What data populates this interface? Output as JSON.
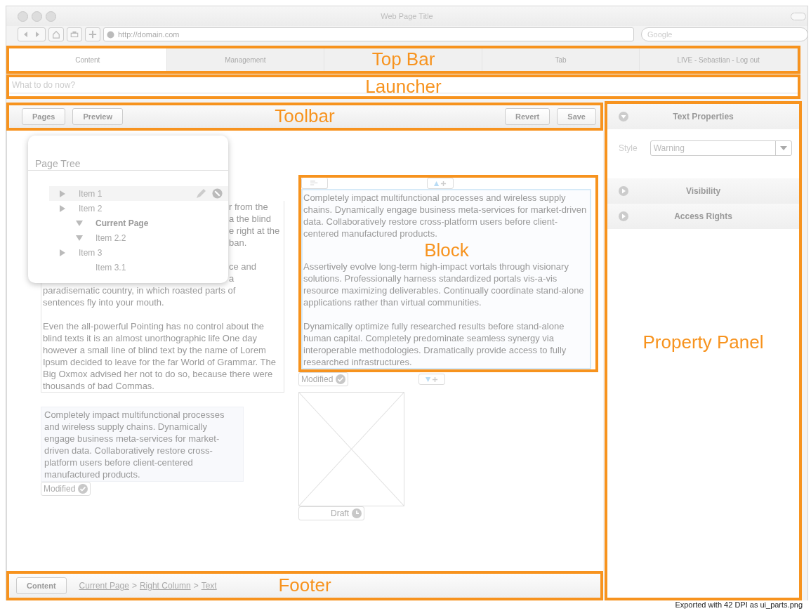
{
  "browser": {
    "title": "Web Page Title",
    "url": "http://domain.com",
    "search_placeholder": "Google"
  },
  "top_bar": {
    "annotation": "Top Bar",
    "tabs": [
      {
        "label": "Content",
        "selected": true
      },
      {
        "label": "Management",
        "selected": false
      },
      {
        "label": "Tab",
        "selected": false
      }
    ],
    "user_menu": "LIVE - Sebastian - Log out"
  },
  "launcher": {
    "annotation": "Launcher",
    "placeholder": "What to do now?"
  },
  "toolbar": {
    "annotation": "Toolbar",
    "left_buttons": [
      "Pages",
      "Preview"
    ],
    "right_buttons": [
      "Revert",
      "Save"
    ]
  },
  "page_tree": {
    "title": "Page Tree",
    "items": [
      {
        "label": "Item 1",
        "expanded": false,
        "selected": true,
        "current": false
      },
      {
        "label": "Item 2",
        "expanded": false,
        "selected": false,
        "current": false,
        "children": [
          {
            "label": "Current Page",
            "expanded": true,
            "selected": false,
            "current": true
          },
          {
            "label": "Item 2.2",
            "expanded": true,
            "selected": false,
            "current": false
          }
        ]
      },
      {
        "label": "Item 3",
        "expanded": false,
        "selected": false,
        "current": false,
        "children": [
          {
            "label": "Item 3.1",
            "selected": false,
            "current": false
          }
        ]
      }
    ]
  },
  "left_column": {
    "text_block": {
      "paragraphs": [
        {
          "partial_lines": [
            "r from the",
            "a the blind",
            "e right at the",
            "ban."
          ]
        },
        {
          "partial_lines": [
            "ce and",
            "a"
          ],
          "lines": [
            "paradisematic country, in which roasted parts of",
            "sentences fly into your mouth."
          ]
        },
        {
          "text": "Even the all-powerful Pointing has no control about the blind texts it is an almost unorthographic life One day however a small line of blind text by the name of Lorem Ipsum decided to leave for the far World of Grammar. The Big Oxmox advised her not to do so, because there were thousands of bad Commas."
        }
      ]
    },
    "block": {
      "text": "Completely impact multifunctional processes and wireless supply chains. Dynamically engage business meta-services for market-driven data. Collaboratively restore cross-platform users before client-centered manufactured products.",
      "status": {
        "text": "Modified",
        "kind": "check"
      }
    }
  },
  "right_column": {
    "block": {
      "annotation": "Block",
      "paragraphs": [
        "Completely impact multifunctional processes and wireless supply chains. Dynamically engage business meta-services for market-driven data. Collaboratively restore cross-platform users before client-centered manufactured products.",
        "Assertively evolve long-term high-impact vortals through visionary solutions. Professionally harness standardized portals vis-a-vis resource maximizing deliverables. Continually coordinate stand-alone applications rather than virtual communities.",
        "Dynamically optimize fully researched results before stand-alone human capital. Completely predominate seamless synergy via interoperable methodologies. Dramatically provide access to fully researched infrastructures."
      ],
      "status": {
        "text": "Modified",
        "kind": "check"
      }
    },
    "image": {
      "status": {
        "text": "Draft",
        "kind": "clock"
      }
    }
  },
  "footer": {
    "annotation": "Footer",
    "button": "Content",
    "breadcrumb": [
      "Current Page",
      "Right Column",
      "Text"
    ],
    "separator": ">"
  },
  "property_panel": {
    "annotation": "Property Panel",
    "sections": [
      {
        "title": "Text Properties",
        "expanded": true,
        "fields": [
          {
            "label": "Style",
            "value": "Warning"
          }
        ]
      },
      {
        "title": "Visibility",
        "expanded": false
      },
      {
        "title": "Access Rights",
        "expanded": false
      }
    ]
  },
  "export_note": "Exported with 42 DPI as ui_parts.png"
}
